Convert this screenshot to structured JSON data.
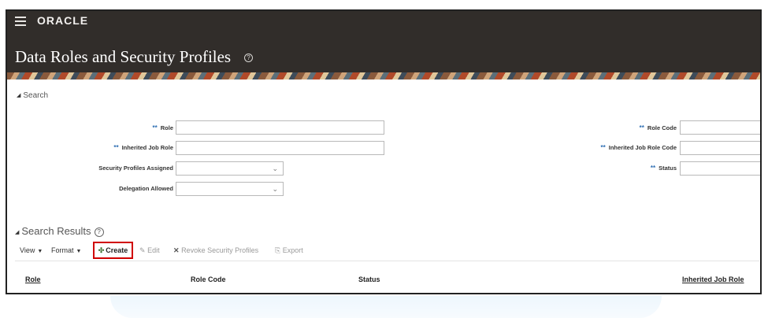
{
  "header": {
    "logo_text": "ORACLE",
    "title": "Data Roles and Security Profiles",
    "help_icon": "?"
  },
  "search": {
    "section_label": "Search",
    "required_marker": "**",
    "fields": {
      "role": {
        "label": "Role",
        "value": ""
      },
      "inherited_job_role": {
        "label": "Inherited Job Role",
        "value": ""
      },
      "security_profiles_assigned": {
        "label": "Security Profiles Assigned",
        "value": ""
      },
      "delegation_allowed": {
        "label": "Delegation Allowed",
        "value": ""
      },
      "role_code": {
        "label": "Role Code",
        "value": ""
      },
      "inherited_job_role_code": {
        "label": "Inherited Job Role Code",
        "value": ""
      },
      "status": {
        "label": "Status",
        "value": ""
      }
    }
  },
  "results": {
    "section_label": "Search Results",
    "help_icon": "?",
    "toolbar": {
      "view_label": "View",
      "format_label": "Format",
      "create_label": "Create",
      "edit_label": "Edit",
      "revoke_label": "Revoke Security Profiles",
      "export_label": "Export"
    },
    "columns": [
      "Role",
      "Role Code",
      "Status",
      "Inherited Job Role"
    ]
  },
  "icons": {
    "menu": "hamburger-icon",
    "dropdown": "chevron-down-icon",
    "create": "plus-icon",
    "edit": "pencil-icon",
    "revoke": "x-icon",
    "export": "export-icon"
  },
  "colors": {
    "header_bg": "#312d2a",
    "required_marker": "#2f6fb3",
    "create_highlight": "#d00000"
  }
}
